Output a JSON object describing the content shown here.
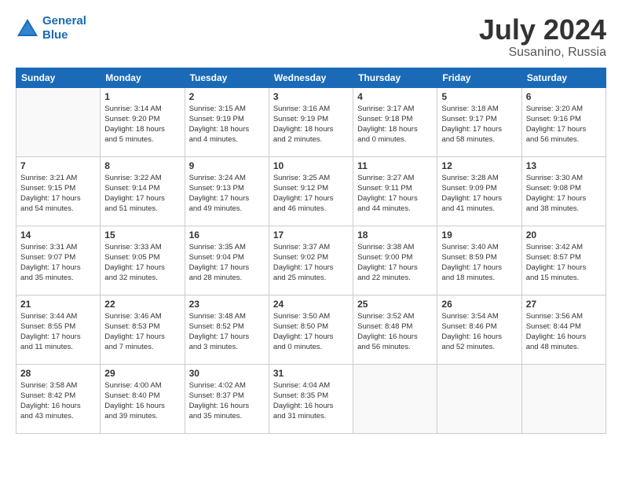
{
  "header": {
    "logo_line1": "General",
    "logo_line2": "Blue",
    "main_title": "July 2024",
    "subtitle": "Susanino, Russia"
  },
  "days": [
    "Sunday",
    "Monday",
    "Tuesday",
    "Wednesday",
    "Thursday",
    "Friday",
    "Saturday"
  ],
  "weeks": [
    [
      {
        "date": "",
        "info": ""
      },
      {
        "date": "1",
        "info": "Sunrise: 3:14 AM\nSunset: 9:20 PM\nDaylight: 18 hours\nand 5 minutes."
      },
      {
        "date": "2",
        "info": "Sunrise: 3:15 AM\nSunset: 9:19 PM\nDaylight: 18 hours\nand 4 minutes."
      },
      {
        "date": "3",
        "info": "Sunrise: 3:16 AM\nSunset: 9:19 PM\nDaylight: 18 hours\nand 2 minutes."
      },
      {
        "date": "4",
        "info": "Sunrise: 3:17 AM\nSunset: 9:18 PM\nDaylight: 18 hours\nand 0 minutes."
      },
      {
        "date": "5",
        "info": "Sunrise: 3:18 AM\nSunset: 9:17 PM\nDaylight: 17 hours\nand 58 minutes."
      },
      {
        "date": "6",
        "info": "Sunrise: 3:20 AM\nSunset: 9:16 PM\nDaylight: 17 hours\nand 56 minutes."
      }
    ],
    [
      {
        "date": "7",
        "info": "Sunrise: 3:21 AM\nSunset: 9:15 PM\nDaylight: 17 hours\nand 54 minutes."
      },
      {
        "date": "8",
        "info": "Sunrise: 3:22 AM\nSunset: 9:14 PM\nDaylight: 17 hours\nand 51 minutes."
      },
      {
        "date": "9",
        "info": "Sunrise: 3:24 AM\nSunset: 9:13 PM\nDaylight: 17 hours\nand 49 minutes."
      },
      {
        "date": "10",
        "info": "Sunrise: 3:25 AM\nSunset: 9:12 PM\nDaylight: 17 hours\nand 46 minutes."
      },
      {
        "date": "11",
        "info": "Sunrise: 3:27 AM\nSunset: 9:11 PM\nDaylight: 17 hours\nand 44 minutes."
      },
      {
        "date": "12",
        "info": "Sunrise: 3:28 AM\nSunset: 9:09 PM\nDaylight: 17 hours\nand 41 minutes."
      },
      {
        "date": "13",
        "info": "Sunrise: 3:30 AM\nSunset: 9:08 PM\nDaylight: 17 hours\nand 38 minutes."
      }
    ],
    [
      {
        "date": "14",
        "info": "Sunrise: 3:31 AM\nSunset: 9:07 PM\nDaylight: 17 hours\nand 35 minutes."
      },
      {
        "date": "15",
        "info": "Sunrise: 3:33 AM\nSunset: 9:05 PM\nDaylight: 17 hours\nand 32 minutes."
      },
      {
        "date": "16",
        "info": "Sunrise: 3:35 AM\nSunset: 9:04 PM\nDaylight: 17 hours\nand 28 minutes."
      },
      {
        "date": "17",
        "info": "Sunrise: 3:37 AM\nSunset: 9:02 PM\nDaylight: 17 hours\nand 25 minutes."
      },
      {
        "date": "18",
        "info": "Sunrise: 3:38 AM\nSunset: 9:00 PM\nDaylight: 17 hours\nand 22 minutes."
      },
      {
        "date": "19",
        "info": "Sunrise: 3:40 AM\nSunset: 8:59 PM\nDaylight: 17 hours\nand 18 minutes."
      },
      {
        "date": "20",
        "info": "Sunrise: 3:42 AM\nSunset: 8:57 PM\nDaylight: 17 hours\nand 15 minutes."
      }
    ],
    [
      {
        "date": "21",
        "info": "Sunrise: 3:44 AM\nSunset: 8:55 PM\nDaylight: 17 hours\nand 11 minutes."
      },
      {
        "date": "22",
        "info": "Sunrise: 3:46 AM\nSunset: 8:53 PM\nDaylight: 17 hours\nand 7 minutes."
      },
      {
        "date": "23",
        "info": "Sunrise: 3:48 AM\nSunset: 8:52 PM\nDaylight: 17 hours\nand 3 minutes."
      },
      {
        "date": "24",
        "info": "Sunrise: 3:50 AM\nSunset: 8:50 PM\nDaylight: 17 hours\nand 0 minutes."
      },
      {
        "date": "25",
        "info": "Sunrise: 3:52 AM\nSunset: 8:48 PM\nDaylight: 16 hours\nand 56 minutes."
      },
      {
        "date": "26",
        "info": "Sunrise: 3:54 AM\nSunset: 8:46 PM\nDaylight: 16 hours\nand 52 minutes."
      },
      {
        "date": "27",
        "info": "Sunrise: 3:56 AM\nSunset: 8:44 PM\nDaylight: 16 hours\nand 48 minutes."
      }
    ],
    [
      {
        "date": "28",
        "info": "Sunrise: 3:58 AM\nSunset: 8:42 PM\nDaylight: 16 hours\nand 43 minutes."
      },
      {
        "date": "29",
        "info": "Sunrise: 4:00 AM\nSunset: 8:40 PM\nDaylight: 16 hours\nand 39 minutes."
      },
      {
        "date": "30",
        "info": "Sunrise: 4:02 AM\nSunset: 8:37 PM\nDaylight: 16 hours\nand 35 minutes."
      },
      {
        "date": "31",
        "info": "Sunrise: 4:04 AM\nSunset: 8:35 PM\nDaylight: 16 hours\nand 31 minutes."
      },
      {
        "date": "",
        "info": ""
      },
      {
        "date": "",
        "info": ""
      },
      {
        "date": "",
        "info": ""
      }
    ]
  ]
}
